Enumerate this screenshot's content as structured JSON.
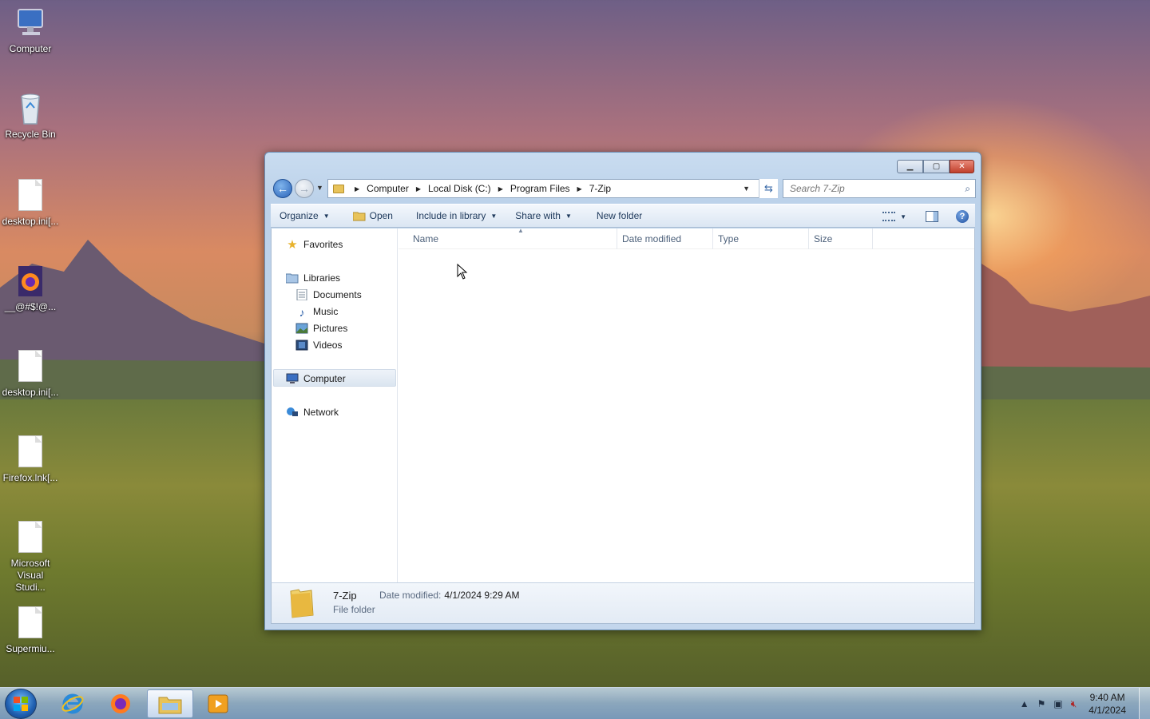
{
  "desktop": {
    "icons": [
      {
        "label": "Computer",
        "icon": "computer-icon"
      },
      {
        "label": "Recycle Bin",
        "icon": "recycle-bin-icon"
      },
      {
        "label": "desktop.ini[...",
        "icon": "document-icon"
      },
      {
        "label": "__@#$!@...",
        "icon": "firefox-icon"
      },
      {
        "label": "desktop.ini[...",
        "icon": "document-icon"
      },
      {
        "label": "Firefox.lnk[...",
        "icon": "document-icon"
      },
      {
        "label": "Microsoft Visual Studi...",
        "icon": "document-icon"
      },
      {
        "label": "Supermiu...",
        "icon": "document-icon"
      }
    ]
  },
  "window": {
    "controls": {
      "minimize": "minimize-icon",
      "maximize": "maximize-icon",
      "close": "close-icon"
    },
    "breadcrumb": [
      "Computer",
      "Local Disk (C:)",
      "Program Files",
      "7-Zip"
    ],
    "search_placeholder": "Search 7-Zip",
    "toolbar": {
      "organize": "Organize",
      "open": "Open",
      "include_in_library": "Include in library",
      "share_with": "Share with",
      "new_folder": "New folder"
    },
    "navpane": {
      "favorites": "Favorites",
      "libraries": "Libraries",
      "documents": "Documents",
      "music": "Music",
      "pictures": "Pictures",
      "videos": "Videos",
      "computer": "Computer",
      "network": "Network"
    },
    "columns": [
      "Name",
      "Date modified",
      "Type",
      "Size"
    ],
    "details": {
      "name": "7-Zip",
      "type": "File folder",
      "date_label": "Date modified:",
      "date_value": "4/1/2024 9:29 AM"
    }
  },
  "taskbar": {
    "apps": [
      "internet-explorer-icon",
      "firefox-icon",
      "windows-explorer-icon",
      "media-player-icon"
    ],
    "clock": {
      "time": "9:40 AM",
      "date": "4/1/2024"
    }
  }
}
